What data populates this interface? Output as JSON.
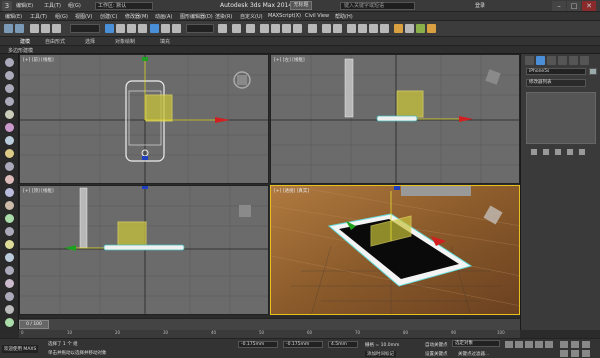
{
  "titlebar": {
    "logo": "3",
    "menus": [
      "编辑(E)",
      "工具(T)",
      "组(G)"
    ],
    "workspace": "工作区: 默认",
    "app_title": "Autodesk 3ds Max 2014",
    "doc_name": "无标题",
    "search_placeholder": "键入关键字或短语",
    "login": "登录"
  },
  "menubar": {
    "items": [
      "编辑(E)",
      "工具(T)",
      "组(G)",
      "视图(V)",
      "创建(C)",
      "修改器(M)",
      "动画(A)",
      "图形编辑器(D)",
      "渲染(R)",
      "自定义(U)",
      "MAXScript(X)",
      "Civil View",
      "帮助(H)"
    ]
  },
  "ribbon": {
    "tabs": [
      "建模",
      "自由形式",
      "选择",
      "对象绘制",
      "填充"
    ],
    "sub": "多边形建模"
  },
  "viewports": [
    {
      "label": "[+] [前] [线框]"
    },
    {
      "label": "[+] [左] [线框]"
    },
    {
      "label": "[+] [顶] [线框]"
    },
    {
      "label": "[+] [透视] [真实]"
    }
  ],
  "rpanel": {
    "name": "iPhone5s",
    "modifier_list": "修改器列表"
  },
  "timeline": {
    "frame": "0 / 100",
    "ticks": [
      "0",
      "10",
      "20",
      "30",
      "40",
      "50",
      "60",
      "70",
      "80",
      "90",
      "100"
    ]
  },
  "status": {
    "welcome": "欢迎使用 MAXS",
    "selected": "选择了 1 个 组",
    "hint": "单击并拖动以选择并移动对象",
    "x": "-0.175mm",
    "y": "-0.175mm",
    "z": "4.5mm",
    "grid": "栅格 = 10.0mm",
    "autokey": "自动关键点",
    "setkey": "设置关键点",
    "selobj": "选定对象",
    "keyfilter": "关键点过滤器...",
    "addtime": "添加时间标记"
  },
  "colors": {
    "accent": "#4a90d9",
    "viewport_bg": "#6b6b6b",
    "wood": "#8a5a2a"
  }
}
